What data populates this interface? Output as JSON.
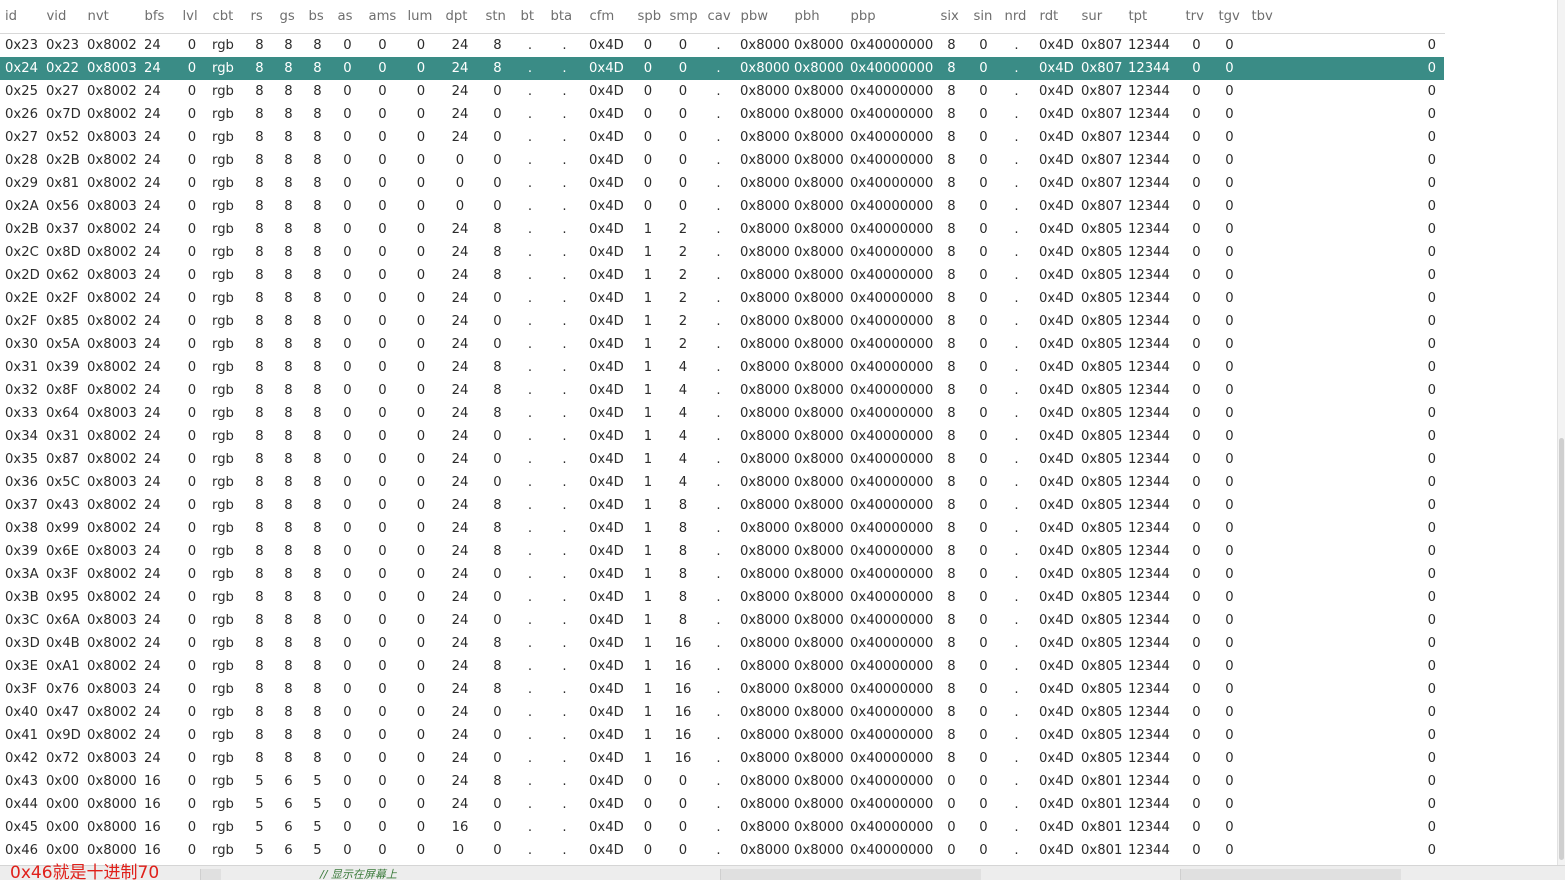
{
  "columns": [
    "id",
    "vid",
    "nvt",
    "bfs",
    "lvl",
    "cbt",
    "rs",
    "gs",
    "bs",
    "as",
    "ams",
    "lum",
    "dpt",
    "stn",
    "bt",
    "bta",
    "cfm",
    "spb",
    "smp",
    "cav",
    "pbw",
    "pbh",
    "pbp",
    "six",
    "sin",
    "nrd",
    "rdt",
    "sur",
    "tpt",
    "trv",
    "tgv",
    "tbv",
    ""
  ],
  "rows": [
    [
      "0x23",
      "0x23",
      "0x8002",
      "24",
      "0",
      "rgb",
      "8",
      "8",
      "8",
      "0",
      "0",
      "0",
      "24",
      "8",
      ".",
      ".",
      "0x4D",
      "0",
      "0",
      ".",
      "0x8000",
      "0x8000",
      "0x40000000",
      "8",
      "0",
      ".",
      "0x4D",
      "0x807",
      "12344",
      "0",
      "0",
      "",
      "0"
    ],
    [
      "0x24",
      "0x22",
      "0x8003",
      "24",
      "0",
      "rgb",
      "8",
      "8",
      "8",
      "0",
      "0",
      "0",
      "24",
      "8",
      ".",
      ".",
      "0x4D",
      "0",
      "0",
      ".",
      "0x8000",
      "0x8000",
      "0x40000000",
      "8",
      "0",
      ".",
      "0x4D",
      "0x807",
      "12344",
      "0",
      "0",
      "",
      "0"
    ],
    [
      "0x25",
      "0x27",
      "0x8002",
      "24",
      "0",
      "rgb",
      "8",
      "8",
      "8",
      "0",
      "0",
      "0",
      "24",
      "0",
      ".",
      ".",
      "0x4D",
      "0",
      "0",
      ".",
      "0x8000",
      "0x8000",
      "0x40000000",
      "8",
      "0",
      ".",
      "0x4D",
      "0x807",
      "12344",
      "0",
      "0",
      "",
      "0"
    ],
    [
      "0x26",
      "0x7D",
      "0x8002",
      "24",
      "0",
      "rgb",
      "8",
      "8",
      "8",
      "0",
      "0",
      "0",
      "24",
      "0",
      ".",
      ".",
      "0x4D",
      "0",
      "0",
      ".",
      "0x8000",
      "0x8000",
      "0x40000000",
      "8",
      "0",
      ".",
      "0x4D",
      "0x807",
      "12344",
      "0",
      "0",
      "",
      "0"
    ],
    [
      "0x27",
      "0x52",
      "0x8003",
      "24",
      "0",
      "rgb",
      "8",
      "8",
      "8",
      "0",
      "0",
      "0",
      "24",
      "0",
      ".",
      ".",
      "0x4D",
      "0",
      "0",
      ".",
      "0x8000",
      "0x8000",
      "0x40000000",
      "8",
      "0",
      ".",
      "0x4D",
      "0x807",
      "12344",
      "0",
      "0",
      "",
      "0"
    ],
    [
      "0x28",
      "0x2B",
      "0x8002",
      "24",
      "0",
      "rgb",
      "8",
      "8",
      "8",
      "0",
      "0",
      "0",
      "0",
      "0",
      ".",
      ".",
      "0x4D",
      "0",
      "0",
      ".",
      "0x8000",
      "0x8000",
      "0x40000000",
      "8",
      "0",
      ".",
      "0x4D",
      "0x807",
      "12344",
      "0",
      "0",
      "",
      "0"
    ],
    [
      "0x29",
      "0x81",
      "0x8002",
      "24",
      "0",
      "rgb",
      "8",
      "8",
      "8",
      "0",
      "0",
      "0",
      "0",
      "0",
      ".",
      ".",
      "0x4D",
      "0",
      "0",
      ".",
      "0x8000",
      "0x8000",
      "0x40000000",
      "8",
      "0",
      ".",
      "0x4D",
      "0x807",
      "12344",
      "0",
      "0",
      "",
      "0"
    ],
    [
      "0x2A",
      "0x56",
      "0x8003",
      "24",
      "0",
      "rgb",
      "8",
      "8",
      "8",
      "0",
      "0",
      "0",
      "0",
      "0",
      ".",
      ".",
      "0x4D",
      "0",
      "0",
      ".",
      "0x8000",
      "0x8000",
      "0x40000000",
      "8",
      "0",
      ".",
      "0x4D",
      "0x807",
      "12344",
      "0",
      "0",
      "",
      "0"
    ],
    [
      "0x2B",
      "0x37",
      "0x8002",
      "24",
      "0",
      "rgb",
      "8",
      "8",
      "8",
      "0",
      "0",
      "0",
      "24",
      "8",
      ".",
      ".",
      "0x4D",
      "1",
      "2",
      ".",
      "0x8000",
      "0x8000",
      "0x40000000",
      "8",
      "0",
      ".",
      "0x4D",
      "0x805",
      "12344",
      "0",
      "0",
      "",
      "0"
    ],
    [
      "0x2C",
      "0x8D",
      "0x8002",
      "24",
      "0",
      "rgb",
      "8",
      "8",
      "8",
      "0",
      "0",
      "0",
      "24",
      "8",
      ".",
      ".",
      "0x4D",
      "1",
      "2",
      ".",
      "0x8000",
      "0x8000",
      "0x40000000",
      "8",
      "0",
      ".",
      "0x4D",
      "0x805",
      "12344",
      "0",
      "0",
      "",
      "0"
    ],
    [
      "0x2D",
      "0x62",
      "0x8003",
      "24",
      "0",
      "rgb",
      "8",
      "8",
      "8",
      "0",
      "0",
      "0",
      "24",
      "8",
      ".",
      ".",
      "0x4D",
      "1",
      "2",
      ".",
      "0x8000",
      "0x8000",
      "0x40000000",
      "8",
      "0",
      ".",
      "0x4D",
      "0x805",
      "12344",
      "0",
      "0",
      "",
      "0"
    ],
    [
      "0x2E",
      "0x2F",
      "0x8002",
      "24",
      "0",
      "rgb",
      "8",
      "8",
      "8",
      "0",
      "0",
      "0",
      "24",
      "0",
      ".",
      ".",
      "0x4D",
      "1",
      "2",
      ".",
      "0x8000",
      "0x8000",
      "0x40000000",
      "8",
      "0",
      ".",
      "0x4D",
      "0x805",
      "12344",
      "0",
      "0",
      "",
      "0"
    ],
    [
      "0x2F",
      "0x85",
      "0x8002",
      "24",
      "0",
      "rgb",
      "8",
      "8",
      "8",
      "0",
      "0",
      "0",
      "24",
      "0",
      ".",
      ".",
      "0x4D",
      "1",
      "2",
      ".",
      "0x8000",
      "0x8000",
      "0x40000000",
      "8",
      "0",
      ".",
      "0x4D",
      "0x805",
      "12344",
      "0",
      "0",
      "",
      "0"
    ],
    [
      "0x30",
      "0x5A",
      "0x8003",
      "24",
      "0",
      "rgb",
      "8",
      "8",
      "8",
      "0",
      "0",
      "0",
      "24",
      "0",
      ".",
      ".",
      "0x4D",
      "1",
      "2",
      ".",
      "0x8000",
      "0x8000",
      "0x40000000",
      "8",
      "0",
      ".",
      "0x4D",
      "0x805",
      "12344",
      "0",
      "0",
      "",
      "0"
    ],
    [
      "0x31",
      "0x39",
      "0x8002",
      "24",
      "0",
      "rgb",
      "8",
      "8",
      "8",
      "0",
      "0",
      "0",
      "24",
      "8",
      ".",
      ".",
      "0x4D",
      "1",
      "4",
      ".",
      "0x8000",
      "0x8000",
      "0x40000000",
      "8",
      "0",
      ".",
      "0x4D",
      "0x805",
      "12344",
      "0",
      "0",
      "",
      "0"
    ],
    [
      "0x32",
      "0x8F",
      "0x8002",
      "24",
      "0",
      "rgb",
      "8",
      "8",
      "8",
      "0",
      "0",
      "0",
      "24",
      "8",
      ".",
      ".",
      "0x4D",
      "1",
      "4",
      ".",
      "0x8000",
      "0x8000",
      "0x40000000",
      "8",
      "0",
      ".",
      "0x4D",
      "0x805",
      "12344",
      "0",
      "0",
      "",
      "0"
    ],
    [
      "0x33",
      "0x64",
      "0x8003",
      "24",
      "0",
      "rgb",
      "8",
      "8",
      "8",
      "0",
      "0",
      "0",
      "24",
      "8",
      ".",
      ".",
      "0x4D",
      "1",
      "4",
      ".",
      "0x8000",
      "0x8000",
      "0x40000000",
      "8",
      "0",
      ".",
      "0x4D",
      "0x805",
      "12344",
      "0",
      "0",
      "",
      "0"
    ],
    [
      "0x34",
      "0x31",
      "0x8002",
      "24",
      "0",
      "rgb",
      "8",
      "8",
      "8",
      "0",
      "0",
      "0",
      "24",
      "0",
      ".",
      ".",
      "0x4D",
      "1",
      "4",
      ".",
      "0x8000",
      "0x8000",
      "0x40000000",
      "8",
      "0",
      ".",
      "0x4D",
      "0x805",
      "12344",
      "0",
      "0",
      "",
      "0"
    ],
    [
      "0x35",
      "0x87",
      "0x8002",
      "24",
      "0",
      "rgb",
      "8",
      "8",
      "8",
      "0",
      "0",
      "0",
      "24",
      "0",
      ".",
      ".",
      "0x4D",
      "1",
      "4",
      ".",
      "0x8000",
      "0x8000",
      "0x40000000",
      "8",
      "0",
      ".",
      "0x4D",
      "0x805",
      "12344",
      "0",
      "0",
      "",
      "0"
    ],
    [
      "0x36",
      "0x5C",
      "0x8003",
      "24",
      "0",
      "rgb",
      "8",
      "8",
      "8",
      "0",
      "0",
      "0",
      "24",
      "0",
      ".",
      ".",
      "0x4D",
      "1",
      "4",
      ".",
      "0x8000",
      "0x8000",
      "0x40000000",
      "8",
      "0",
      ".",
      "0x4D",
      "0x805",
      "12344",
      "0",
      "0",
      "",
      "0"
    ],
    [
      "0x37",
      "0x43",
      "0x8002",
      "24",
      "0",
      "rgb",
      "8",
      "8",
      "8",
      "0",
      "0",
      "0",
      "24",
      "8",
      ".",
      ".",
      "0x4D",
      "1",
      "8",
      ".",
      "0x8000",
      "0x8000",
      "0x40000000",
      "8",
      "0",
      ".",
      "0x4D",
      "0x805",
      "12344",
      "0",
      "0",
      "",
      "0"
    ],
    [
      "0x38",
      "0x99",
      "0x8002",
      "24",
      "0",
      "rgb",
      "8",
      "8",
      "8",
      "0",
      "0",
      "0",
      "24",
      "8",
      ".",
      ".",
      "0x4D",
      "1",
      "8",
      ".",
      "0x8000",
      "0x8000",
      "0x40000000",
      "8",
      "0",
      ".",
      "0x4D",
      "0x805",
      "12344",
      "0",
      "0",
      "",
      "0"
    ],
    [
      "0x39",
      "0x6E",
      "0x8003",
      "24",
      "0",
      "rgb",
      "8",
      "8",
      "8",
      "0",
      "0",
      "0",
      "24",
      "8",
      ".",
      ".",
      "0x4D",
      "1",
      "8",
      ".",
      "0x8000",
      "0x8000",
      "0x40000000",
      "8",
      "0",
      ".",
      "0x4D",
      "0x805",
      "12344",
      "0",
      "0",
      "",
      "0"
    ],
    [
      "0x3A",
      "0x3F",
      "0x8002",
      "24",
      "0",
      "rgb",
      "8",
      "8",
      "8",
      "0",
      "0",
      "0",
      "24",
      "0",
      ".",
      ".",
      "0x4D",
      "1",
      "8",
      ".",
      "0x8000",
      "0x8000",
      "0x40000000",
      "8",
      "0",
      ".",
      "0x4D",
      "0x805",
      "12344",
      "0",
      "0",
      "",
      "0"
    ],
    [
      "0x3B",
      "0x95",
      "0x8002",
      "24",
      "0",
      "rgb",
      "8",
      "8",
      "8",
      "0",
      "0",
      "0",
      "24",
      "0",
      ".",
      ".",
      "0x4D",
      "1",
      "8",
      ".",
      "0x8000",
      "0x8000",
      "0x40000000",
      "8",
      "0",
      ".",
      "0x4D",
      "0x805",
      "12344",
      "0",
      "0",
      "",
      "0"
    ],
    [
      "0x3C",
      "0x6A",
      "0x8003",
      "24",
      "0",
      "rgb",
      "8",
      "8",
      "8",
      "0",
      "0",
      "0",
      "24",
      "0",
      ".",
      ".",
      "0x4D",
      "1",
      "8",
      ".",
      "0x8000",
      "0x8000",
      "0x40000000",
      "8",
      "0",
      ".",
      "0x4D",
      "0x805",
      "12344",
      "0",
      "0",
      "",
      "0"
    ],
    [
      "0x3D",
      "0x4B",
      "0x8002",
      "24",
      "0",
      "rgb",
      "8",
      "8",
      "8",
      "0",
      "0",
      "0",
      "24",
      "8",
      ".",
      ".",
      "0x4D",
      "1",
      "16",
      ".",
      "0x8000",
      "0x8000",
      "0x40000000",
      "8",
      "0",
      ".",
      "0x4D",
      "0x805",
      "12344",
      "0",
      "0",
      "",
      "0"
    ],
    [
      "0x3E",
      "0xA1",
      "0x8002",
      "24",
      "0",
      "rgb",
      "8",
      "8",
      "8",
      "0",
      "0",
      "0",
      "24",
      "8",
      ".",
      ".",
      "0x4D",
      "1",
      "16",
      ".",
      "0x8000",
      "0x8000",
      "0x40000000",
      "8",
      "0",
      ".",
      "0x4D",
      "0x805",
      "12344",
      "0",
      "0",
      "",
      "0"
    ],
    [
      "0x3F",
      "0x76",
      "0x8003",
      "24",
      "0",
      "rgb",
      "8",
      "8",
      "8",
      "0",
      "0",
      "0",
      "24",
      "8",
      ".",
      ".",
      "0x4D",
      "1",
      "16",
      ".",
      "0x8000",
      "0x8000",
      "0x40000000",
      "8",
      "0",
      ".",
      "0x4D",
      "0x805",
      "12344",
      "0",
      "0",
      "",
      "0"
    ],
    [
      "0x40",
      "0x47",
      "0x8002",
      "24",
      "0",
      "rgb",
      "8",
      "8",
      "8",
      "0",
      "0",
      "0",
      "24",
      "0",
      ".",
      ".",
      "0x4D",
      "1",
      "16",
      ".",
      "0x8000",
      "0x8000",
      "0x40000000",
      "8",
      "0",
      ".",
      "0x4D",
      "0x805",
      "12344",
      "0",
      "0",
      "",
      "0"
    ],
    [
      "0x41",
      "0x9D",
      "0x8002",
      "24",
      "0",
      "rgb",
      "8",
      "8",
      "8",
      "0",
      "0",
      "0",
      "24",
      "0",
      ".",
      ".",
      "0x4D",
      "1",
      "16",
      ".",
      "0x8000",
      "0x8000",
      "0x40000000",
      "8",
      "0",
      ".",
      "0x4D",
      "0x805",
      "12344",
      "0",
      "0",
      "",
      "0"
    ],
    [
      "0x42",
      "0x72",
      "0x8003",
      "24",
      "0",
      "rgb",
      "8",
      "8",
      "8",
      "0",
      "0",
      "0",
      "24",
      "0",
      ".",
      ".",
      "0x4D",
      "1",
      "16",
      ".",
      "0x8000",
      "0x8000",
      "0x40000000",
      "8",
      "0",
      ".",
      "0x4D",
      "0x805",
      "12344",
      "0",
      "0",
      "",
      "0"
    ],
    [
      "0x43",
      "0x00",
      "0x8000",
      "16",
      "0",
      "rgb",
      "5",
      "6",
      "5",
      "0",
      "0",
      "0",
      "24",
      "8",
      ".",
      ".",
      "0x4D",
      "0",
      "0",
      ".",
      "0x8000",
      "0x8000",
      "0x40000000",
      "0",
      "0",
      ".",
      "0x4D",
      "0x801",
      "12344",
      "0",
      "0",
      "",
      "0"
    ],
    [
      "0x44",
      "0x00",
      "0x8000",
      "16",
      "0",
      "rgb",
      "5",
      "6",
      "5",
      "0",
      "0",
      "0",
      "24",
      "0",
      ".",
      ".",
      "0x4D",
      "0",
      "0",
      ".",
      "0x8000",
      "0x8000",
      "0x40000000",
      "0",
      "0",
      ".",
      "0x4D",
      "0x801",
      "12344",
      "0",
      "0",
      "",
      "0"
    ],
    [
      "0x45",
      "0x00",
      "0x8000",
      "16",
      "0",
      "rgb",
      "5",
      "6",
      "5",
      "0",
      "0",
      "0",
      "16",
      "0",
      ".",
      ".",
      "0x4D",
      "0",
      "0",
      ".",
      "0x8000",
      "0x8000",
      "0x40000000",
      "0",
      "0",
      ".",
      "0x4D",
      "0x801",
      "12344",
      "0",
      "0",
      "",
      "0"
    ],
    [
      "0x46",
      "0x00",
      "0x8000",
      "16",
      "0",
      "rgb",
      "5",
      "6",
      "5",
      "0",
      "0",
      "0",
      "0",
      "0",
      ".",
      ".",
      "0x4D",
      "0",
      "0",
      ".",
      "0x8000",
      "0x8000",
      "0x40000000",
      "0",
      "0",
      ".",
      "0x4D",
      "0x801",
      "12344",
      "0",
      "0",
      "",
      "0"
    ]
  ],
  "selected_row": 1,
  "colors": {
    "selection_bg": "#3a8c86",
    "annotation": "#e0201a"
  },
  "annotation_text": "0x46就是十进制70",
  "editor_comment": "// 显示在屏幕上"
}
